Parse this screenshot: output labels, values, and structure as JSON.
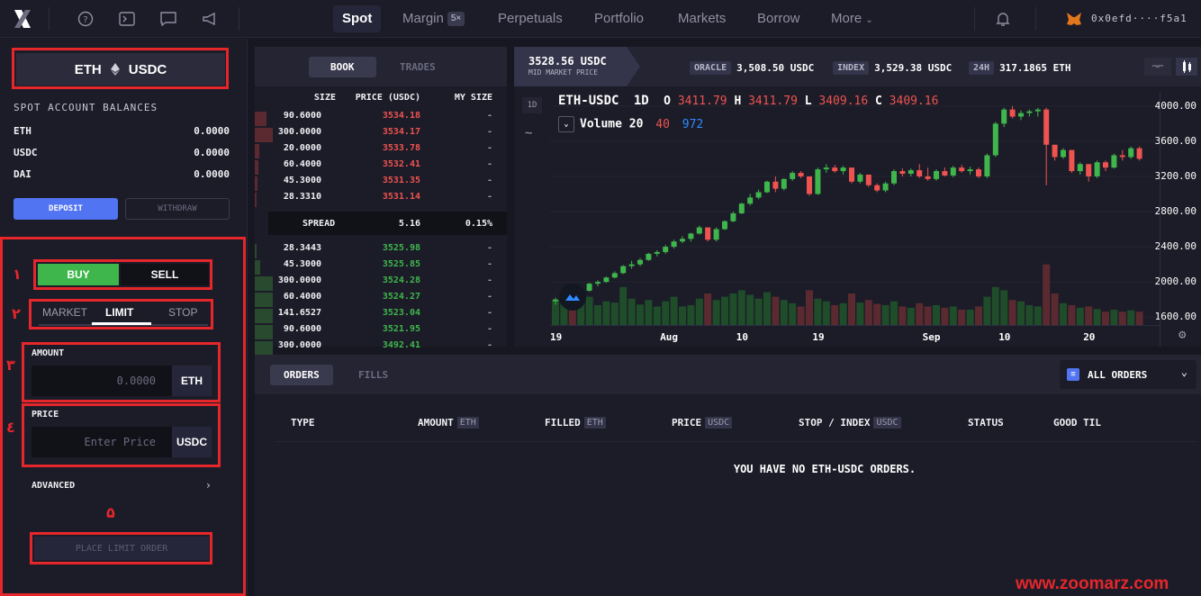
{
  "nav": {
    "tabs": [
      {
        "label": "Spot",
        "active": true
      },
      {
        "label": "Margin",
        "badge": "5×"
      },
      {
        "label": "Perpetuals"
      },
      {
        "label": "Portfolio"
      },
      {
        "label": "Markets"
      },
      {
        "label": "Borrow"
      },
      {
        "label": "More"
      }
    ],
    "wallet": "0x0efd····f5a1"
  },
  "market": {
    "base": "ETH",
    "quote": "USDC"
  },
  "balances": {
    "title": "SPOT ACCOUNT BALANCES",
    "rows": [
      {
        "asset": "ETH",
        "amount": "0.0000"
      },
      {
        "asset": "USDC",
        "amount": "0.0000"
      },
      {
        "asset": "DAI",
        "amount": "0.0000"
      }
    ],
    "deposit_label": "DEPOSIT",
    "withdraw_label": "WITHDRAW"
  },
  "order_form": {
    "buy_label": "BUY",
    "sell_label": "SELL",
    "types": [
      "MARKET",
      "LIMIT",
      "STOP"
    ],
    "active_type": "LIMIT",
    "amount_label": "AMOUNT",
    "amount_placeholder": "0.0000",
    "amount_unit": "ETH",
    "price_label": "PRICE",
    "price_placeholder": "Enter Price",
    "price_unit": "USDC",
    "advanced_label": "ADVANCED",
    "place_label": "PLACE LIMIT ORDER",
    "step_numbers": [
      "١",
      "٢",
      "٣",
      "٤",
      "۵"
    ]
  },
  "book": {
    "tab_book": "BOOK",
    "tab_trades": "TRADES",
    "headers": {
      "size": "SIZE",
      "price": "PRICE (USDC)",
      "mine": "MY SIZE"
    },
    "asks": [
      {
        "size": "90.6000",
        "price": "3534.18",
        "mine": "-",
        "depth": 0.55
      },
      {
        "size": "300.0000",
        "price": "3534.17",
        "mine": "-",
        "depth": 0.85
      },
      {
        "size": "20.0000",
        "price": "3533.78",
        "mine": "-",
        "depth": 0.2
      },
      {
        "size": "60.4000",
        "price": "3532.41",
        "mine": "-",
        "depth": 0.15
      },
      {
        "size": "45.3000",
        "price": "3531.35",
        "mine": "-",
        "depth": 0.12
      },
      {
        "size": "28.3310",
        "price": "3531.14",
        "mine": "-",
        "depth": 0.1
      }
    ],
    "spread_label": "SPREAD",
    "spread_value": "5.16",
    "spread_pct": "0.15%",
    "bids": [
      {
        "size": "28.3443",
        "price": "3525.98",
        "mine": "-",
        "depth": 0.1
      },
      {
        "size": "45.3000",
        "price": "3525.85",
        "mine": "-",
        "depth": 0.25
      },
      {
        "size": "300.0000",
        "price": "3524.28",
        "mine": "-",
        "depth": 0.85
      },
      {
        "size": "60.4000",
        "price": "3524.27",
        "mine": "-",
        "depth": 0.85
      },
      {
        "size": "141.6527",
        "price": "3523.04",
        "mine": "-",
        "depth": 0.85
      },
      {
        "size": "90.6000",
        "price": "3521.95",
        "mine": "-",
        "depth": 0.85
      },
      {
        "size": "300.0000",
        "price": "3492.41",
        "mine": "-",
        "depth": 0.85
      }
    ]
  },
  "chart_header": {
    "mid_price": "3528.56 USDC",
    "mid_label": "MID MARKET PRICE",
    "oracle_label": "ORACLE",
    "oracle_value": "3,508.50 USDC",
    "index_label": "INDEX",
    "index_value": "3,529.38 USDC",
    "vol_label": "24H",
    "vol_value": "317.1865 ETH"
  },
  "chart_data": {
    "type": "candlestick",
    "symbol": "ETH-USDC",
    "interval": "1D",
    "interval_button": "1D",
    "ohlc": {
      "o": "3411.79",
      "h": "3411.79",
      "l": "3409.16",
      "c": "3409.16"
    },
    "volume_label": "Volume 20",
    "volume_values": [
      "40",
      "972"
    ],
    "ylim": [
      1500,
      4100
    ],
    "y_ticks": [
      {
        "value": 4000,
        "label": "4000.00"
      },
      {
        "value": 3600,
        "label": "3600.00"
      },
      {
        "value": 3200,
        "label": "3200.00"
      },
      {
        "value": 2800,
        "label": "2800.00"
      },
      {
        "value": 2400,
        "label": "2400.00"
      },
      {
        "value": 2000,
        "label": "2000.00"
      },
      {
        "value": 1600,
        "label": "1600.00"
      }
    ],
    "x_ticks": [
      {
        "index": 0,
        "label": "19"
      },
      {
        "index": 13,
        "label": "Aug"
      },
      {
        "index": 22,
        "label": "10"
      },
      {
        "index": 31,
        "label": "19"
      },
      {
        "index": 44,
        "label": "Sep"
      },
      {
        "index": 53,
        "label": "10"
      },
      {
        "index": 63,
        "label": "20"
      }
    ],
    "candles": [
      [
        1780,
        1820,
        1740,
        1800,
        0.4
      ],
      [
        1800,
        1880,
        1790,
        1860,
        0.38
      ],
      [
        1860,
        1900,
        1830,
        1850,
        0.3
      ],
      [
        1850,
        1920,
        1840,
        1900,
        0.35
      ],
      [
        1900,
        1990,
        1890,
        1980,
        0.45
      ],
      [
        1980,
        2020,
        1950,
        2000,
        0.32
      ],
      [
        2000,
        2060,
        1990,
        2050,
        0.38
      ],
      [
        2050,
        2120,
        2040,
        2100,
        0.36
      ],
      [
        2100,
        2190,
        2090,
        2180,
        0.6
      ],
      [
        2180,
        2240,
        2150,
        2200,
        0.42
      ],
      [
        2200,
        2270,
        2180,
        2250,
        0.33
      ],
      [
        2250,
        2330,
        2240,
        2320,
        0.4
      ],
      [
        2320,
        2360,
        2290,
        2340,
        0.3
      ],
      [
        2340,
        2420,
        2320,
        2400,
        0.38
      ],
      [
        2400,
        2480,
        2380,
        2460,
        0.45
      ],
      [
        2460,
        2520,
        2440,
        2490,
        0.3
      ],
      [
        2490,
        2560,
        2460,
        2550,
        0.32
      ],
      [
        2550,
        2640,
        2540,
        2620,
        0.42
      ],
      [
        2620,
        2600,
        2460,
        2480,
        0.5
      ],
      [
        2480,
        2620,
        2460,
        2600,
        0.4
      ],
      [
        2600,
        2700,
        2590,
        2690,
        0.45
      ],
      [
        2690,
        2800,
        2680,
        2780,
        0.5
      ],
      [
        2780,
        2900,
        2770,
        2890,
        0.55
      ],
      [
        2890,
        3000,
        2870,
        2960,
        0.48
      ],
      [
        2960,
        3050,
        2940,
        3020,
        0.42
      ],
      [
        3020,
        3150,
        3010,
        3140,
        0.52
      ],
      [
        3140,
        3200,
        3020,
        3060,
        0.45
      ],
      [
        3060,
        3180,
        3040,
        3170,
        0.4
      ],
      [
        3170,
        3260,
        3150,
        3240,
        0.35
      ],
      [
        3240,
        3260,
        3180,
        3200,
        0.3
      ],
      [
        3200,
        3160,
        2980,
        3000,
        0.55
      ],
      [
        3000,
        3300,
        2990,
        3280,
        0.42
      ],
      [
        3280,
        3340,
        3240,
        3300,
        0.38
      ],
      [
        3300,
        3330,
        3240,
        3260,
        0.32
      ],
      [
        3260,
        3320,
        3220,
        3300,
        0.35
      ],
      [
        3300,
        3280,
        3120,
        3140,
        0.5
      ],
      [
        3140,
        3240,
        3120,
        3220,
        0.36
      ],
      [
        3220,
        3220,
        3080,
        3100,
        0.4
      ],
      [
        3100,
        3120,
        3020,
        3040,
        0.34
      ],
      [
        3040,
        3140,
        3020,
        3120,
        0.32
      ],
      [
        3120,
        3280,
        3100,
        3260,
        0.38
      ],
      [
        3260,
        3290,
        3200,
        3230,
        0.3
      ],
      [
        3230,
        3290,
        3200,
        3270,
        0.28
      ],
      [
        3270,
        3340,
        3180,
        3200,
        0.35
      ],
      [
        3200,
        3300,
        3150,
        3170,
        0.3
      ],
      [
        3170,
        3280,
        3150,
        3260,
        0.32
      ],
      [
        3260,
        3300,
        3200,
        3210,
        0.28
      ],
      [
        3210,
        3320,
        3190,
        3300,
        0.3
      ],
      [
        3300,
        3330,
        3240,
        3260,
        0.25
      ],
      [
        3260,
        3310,
        3220,
        3280,
        0.25
      ],
      [
        3280,
        3300,
        3180,
        3200,
        0.3
      ],
      [
        3200,
        3460,
        3180,
        3440,
        0.45
      ],
      [
        3440,
        3820,
        3420,
        3800,
        0.6
      ],
      [
        3800,
        3980,
        3760,
        3960,
        0.55
      ],
      [
        3960,
        4000,
        3860,
        3880,
        0.4
      ],
      [
        3880,
        3950,
        3840,
        3920,
        0.38
      ],
      [
        3920,
        3960,
        3880,
        3940,
        0.32
      ],
      [
        3940,
        3980,
        3880,
        3960,
        0.3
      ],
      [
        3960,
        3980,
        3100,
        3560,
        0.95
      ],
      [
        3560,
        3560,
        3380,
        3420,
        0.5
      ],
      [
        3420,
        3520,
        3400,
        3500,
        0.35
      ],
      [
        3500,
        3470,
        3240,
        3260,
        0.32
      ],
      [
        3260,
        3360,
        3220,
        3340,
        0.28
      ],
      [
        3340,
        3300,
        3140,
        3200,
        0.3
      ],
      [
        3200,
        3380,
        3180,
        3360,
        0.26
      ],
      [
        3360,
        3380,
        3260,
        3300,
        0.22
      ],
      [
        3300,
        3460,
        3290,
        3440,
        0.25
      ],
      [
        3440,
        3500,
        3380,
        3420,
        0.22
      ],
      [
        3420,
        3540,
        3400,
        3520,
        0.24
      ],
      [
        3520,
        3540,
        3380,
        3400,
        0.22
      ]
    ]
  },
  "orders": {
    "tab_orders": "ORDERS",
    "tab_fills": "FILLS",
    "filter_label": "ALL ORDERS",
    "columns": [
      {
        "label": "TYPE"
      },
      {
        "label": "AMOUNT",
        "unit": "ETH"
      },
      {
        "label": "FILLED",
        "unit": "ETH"
      },
      {
        "label": "PRICE",
        "unit": "USDC"
      },
      {
        "label": "STOP / INDEX",
        "unit": "USDC"
      },
      {
        "label": "STATUS"
      },
      {
        "label": "GOOD TIL"
      }
    ],
    "empty_message": "YOU HAVE NO ETH-USDC ORDERS."
  },
  "watermark": "www.zoomarz.com",
  "colors": {
    "buy": "#3fb64c",
    "sell": "#ef5350",
    "accent": "#5174f2",
    "annotation": "#e5262b"
  }
}
